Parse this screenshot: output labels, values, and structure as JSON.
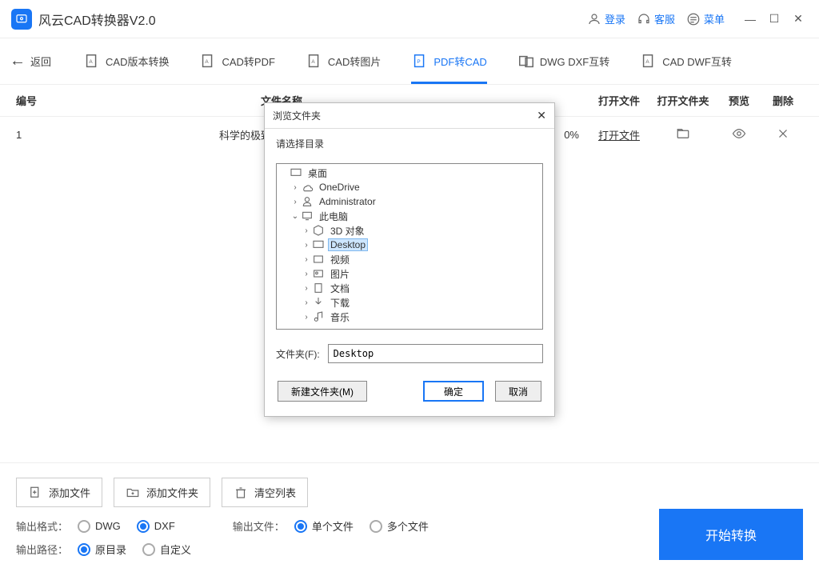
{
  "titlebar": {
    "title": "风云CAD转换器V2.0",
    "login": "登录",
    "support": "客服",
    "menu": "菜单"
  },
  "tabs": {
    "back": "返回",
    "items": [
      {
        "label": "CAD版本转换"
      },
      {
        "label": "CAD转PDF"
      },
      {
        "label": "CAD转图片"
      },
      {
        "label": "PDF转CAD"
      },
      {
        "label": "DWG DXF互转"
      },
      {
        "label": "CAD DWF互转"
      }
    ]
  },
  "tableHeader": {
    "num": "编号",
    "name": "文件名称",
    "open": "打开文件",
    "folder": "打开文件夹",
    "preview": "预览",
    "delete": "删除"
  },
  "rows": [
    {
      "num": "1",
      "name": "科学的极致：漫谈人工智能",
      "progress": "0%",
      "open": "打开文件"
    }
  ],
  "bottom": {
    "addFile": "添加文件",
    "addFolder": "添加文件夹",
    "clear": "清空列表",
    "start": "开始转换",
    "outFormatLabel": "输出格式：",
    "fmtDwg": "DWG",
    "fmtDxf": "DXF",
    "outFileLabel": "输出文件：",
    "single": "单个文件",
    "multi": "多个文件",
    "outPathLabel": "输出路径：",
    "pathSame": "原目录",
    "pathCustom": "自定义"
  },
  "dialog": {
    "title": "浏览文件夹",
    "sub": "请选择目录",
    "tree": {
      "desktop": "桌面",
      "onedrive": "OneDrive",
      "admin": "Administrator",
      "thispc": "此电脑",
      "threeD": "3D 对象",
      "desktopEn": "Desktop",
      "video": "视频",
      "pictures": "图片",
      "docs": "文档",
      "downloads": "下载",
      "music": "音乐"
    },
    "folderLabel": "文件夹(F):",
    "folderValue": "Desktop",
    "newFolder": "新建文件夹(M)",
    "ok": "确定",
    "cancel": "取消"
  }
}
